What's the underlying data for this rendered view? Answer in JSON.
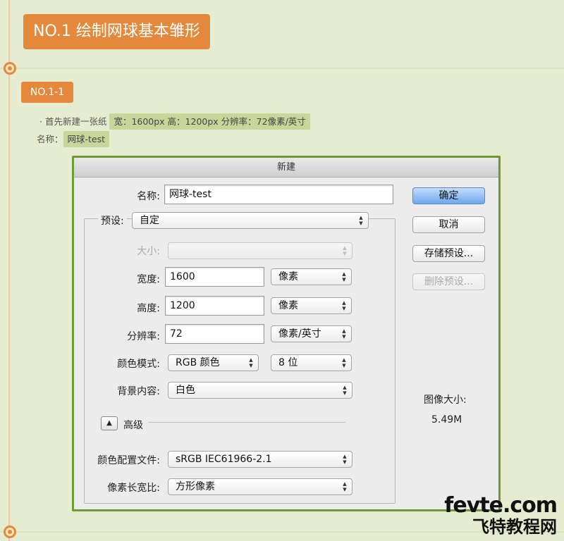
{
  "header": {
    "title": "NO.1  绘制网球基本雏形",
    "step_badge": "NO.1-1"
  },
  "notes": {
    "line1_prefix": "· 首先新建一张纸",
    "line1_highlight": "宽：1600px  高：1200px  分辨率：72像素/英寸",
    "line2_prefix": "名称：",
    "line2_highlight": "网球-test"
  },
  "dialog": {
    "title": "新建",
    "name_label": "名称:",
    "name_value": "网球-test",
    "preset_label": "预设:",
    "preset_value": "自定",
    "size_label": "大小:",
    "size_value": "",
    "width_label": "宽度:",
    "width_value": "1600",
    "width_unit": "像素",
    "height_label": "高度:",
    "height_value": "1200",
    "height_unit": "像素",
    "resolution_label": "分辨率:",
    "resolution_value": "72",
    "resolution_unit": "像素/英寸",
    "color_mode_label": "颜色模式:",
    "color_mode_value": "RGB 颜色",
    "bit_depth_value": "8 位",
    "background_label": "背景内容:",
    "background_value": "白色",
    "advanced_label": "高级",
    "color_profile_label": "颜色配置文件:",
    "color_profile_value": "sRGB IEC61966-2.1",
    "pixel_aspect_label": "像素长宽比:",
    "pixel_aspect_value": "方形像素",
    "image_size_label": "图像大小:",
    "image_size_value": "5.49M",
    "buttons": {
      "ok": "确定",
      "cancel": "取消",
      "save_preset": "存储预设...",
      "delete_preset": "删除预设..."
    }
  },
  "watermark": {
    "line1": "fevte.com",
    "line2": "飞特教程网"
  },
  "colors": {
    "accent_orange": "#e4893b",
    "background": "#e5eccf",
    "highlight": "#c8d69a",
    "dialog_border": "#6d9a35",
    "default_button": "#6ea8ef"
  }
}
